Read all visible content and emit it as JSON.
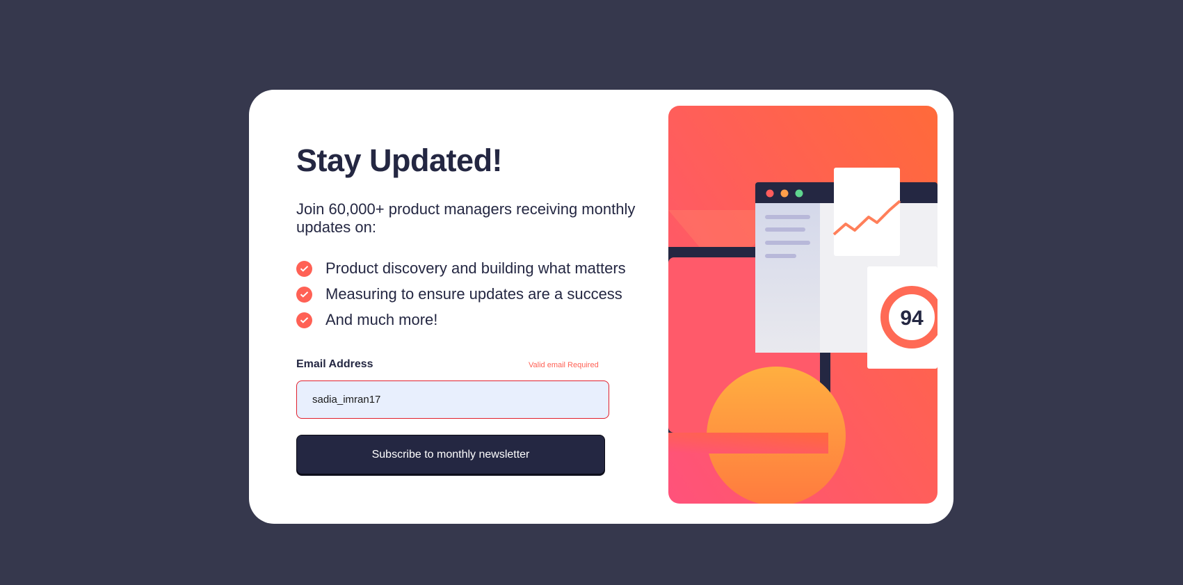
{
  "signup": {
    "title": "Stay Updated!",
    "intro": "Join 60,000+ product managers receiving monthly updates on:",
    "features": [
      "Product discovery and building what matters",
      "Measuring to ensure updates are a success",
      "And much more!"
    ],
    "email_label": "Email Address",
    "email_error": "Valid email Required",
    "email_value": "sadia_imran17",
    "subscribe_label": "Subscribe to monthly newsletter"
  },
  "illustration": {
    "score": "94"
  },
  "colors": {
    "background": "#36384d",
    "dark_navy": "#242742",
    "tomato": "#ff6155",
    "error_border": "#e01f2c",
    "input_fill": "#e8effd"
  },
  "icons": {
    "feature_bullet": "check-icon"
  }
}
